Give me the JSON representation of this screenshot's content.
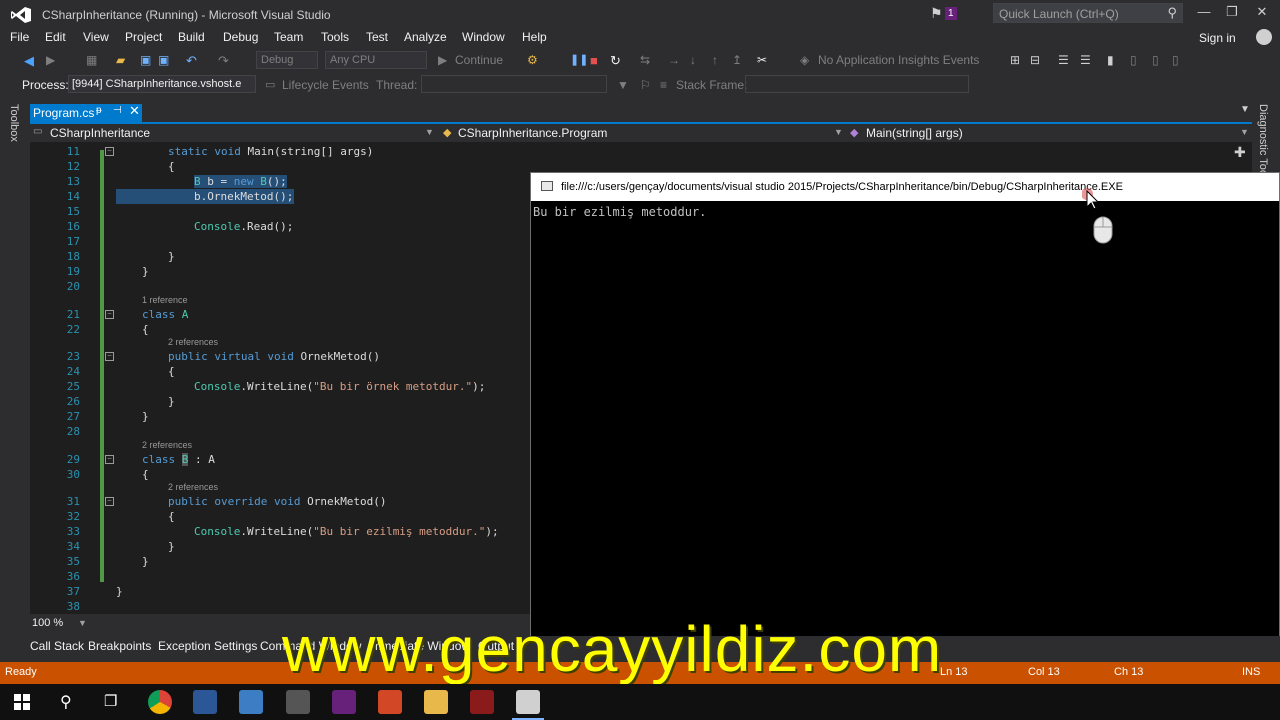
{
  "window": {
    "title": "CSharpInheritance (Running) - Microsoft Visual Studio",
    "notification_count": "1",
    "quick_launch_placeholder": "Quick Launch (Ctrl+Q)",
    "sign_in": "Sign in"
  },
  "menu": [
    "File",
    "Edit",
    "View",
    "Project",
    "Build",
    "Debug",
    "Team",
    "Tools",
    "Test",
    "Analyze",
    "Window",
    "Help"
  ],
  "toolbar": {
    "config": "Debug",
    "platform": "Any CPU",
    "continue": "Continue",
    "insights": "No Application Insights Events",
    "process_label": "Process:",
    "process_value": "[9944] CSharpInheritance.vshost.e",
    "lifecycle": "Lifecycle Events",
    "thread_label": "Thread:",
    "stack_frame_label": "Stack Frame:"
  },
  "side": {
    "toolbox": "Toolbox",
    "diagnostic": "Diagnostic Tools"
  },
  "tab": {
    "name": "Program.cs",
    "pin": "ᵽ",
    "close": "✕"
  },
  "nav": {
    "project": "CSharpInheritance",
    "class": "CSharpInheritance.Program",
    "member": "Main(string[] args)"
  },
  "code": {
    "line_numbers": [
      "11",
      "12",
      "13",
      "14",
      "15",
      "16",
      "17",
      "18",
      "19",
      "20",
      "21",
      "22",
      "23",
      "24",
      "25",
      "26",
      "27",
      "28",
      "29",
      "30",
      "31",
      "32",
      "33",
      "34",
      "35",
      "36",
      "37",
      "38"
    ],
    "refs": {
      "class_a": "1 reference",
      "method_a": "2 references",
      "class_b": "2 references",
      "method_b": "2 references"
    },
    "lines": {
      "l11_kw": "static void",
      "l11_rest": " Main(string[] args)",
      "brace_open": "{",
      "brace_close": "}",
      "l13_type": "B",
      "l13_mid": " b = ",
      "l13_new": "new",
      "l13_type2": "B",
      "l13_end": "();",
      "l14": "b.OrnekMetod();",
      "l16_a": "Console",
      "l16_b": ".Read();",
      "class_kw": "class",
      "class_a_name": "A",
      "class_b_name": "B",
      "class_b_base": " : A",
      "m_a_kw": "public virtual void",
      "m_a_rest": " OrnekMetod()",
      "m_b_kw": "public override void",
      "m_b_rest": " OrnekMetod()",
      "console": "Console",
      "writeline": ".WriteLine(",
      "str_a": "\"Bu bir örnek metotdur.\"",
      "str_b": "\"Bu bir ezilmiş metoddur.\"",
      "end": ");"
    }
  },
  "zoom": "100 %",
  "console_window": {
    "title": "file:///c:/users/gençay/documents/visual studio 2015/Projects/CSharpInheritance/bin/Debug/CSharpInheritance.EXE",
    "output": "Bu bir ezilmiş metoddur."
  },
  "tool_tabs": [
    "Call Stack",
    "Breakpoints",
    "Exception Settings",
    "Command Window",
    "Immediate Window",
    "Output"
  ],
  "status": {
    "state": "Ready",
    "ln": "Ln 13",
    "col": "Col 13",
    "ch": "Ch 13",
    "mode": "INS"
  },
  "watermark": "www.gencayyildiz.com",
  "colors": {
    "accent": "#007acc",
    "status_debug": "#ca5100",
    "keyword": "#569cd6",
    "type": "#4ec9b0",
    "string": "#d69d85"
  }
}
